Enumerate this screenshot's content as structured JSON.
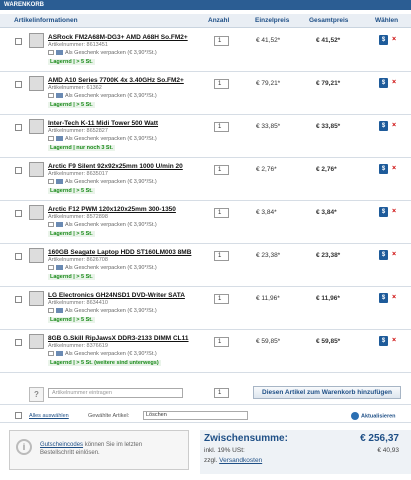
{
  "header": {
    "title": "WARENKORB"
  },
  "columns": {
    "info": "Artikelinformationen",
    "qty": "Anzahl",
    "unit": "Einzelpreis",
    "total": "Gesamtpreis",
    "select": "Wählen"
  },
  "items": [
    {
      "name": "ASRock FM2A68M-DG3+ AMD A68H So.FM2+",
      "art": "Artikelnummer: 8613451",
      "gift": "Als Geschenk verpacken (€ 3,90*/St.)",
      "stock": "Lagernd | > 5 St.",
      "qty": "1",
      "price": "€ 41,52*",
      "total": "€ 41,52*"
    },
    {
      "name": "AMD A10 Series 7700K 4x 3.40GHz So.FM2+",
      "art": "Artikelnummer: 61362",
      "gift": "Als Geschenk verpacken (€ 3,90*/St.)",
      "stock": "Lagernd | > 5 St.",
      "qty": "1",
      "price": "€ 79,21*",
      "total": "€ 79,21*"
    },
    {
      "name": "Inter-Tech K-11 Midi Tower 500 Watt",
      "art": "Artikelnummer: 8652827",
      "gift": "Als Geschenk verpacken (€ 3,90*/St.)",
      "stock": "Lagernd | nur noch 3 St.",
      "qty": "1",
      "price": "€ 33,85*",
      "total": "€ 33,85*"
    },
    {
      "name": "Arctic F9 Silent 92x92x25mm 1000 U/min 20",
      "art": "Artikelnummer: 8635017",
      "gift": "Als Geschenk verpacken (€ 3,90*/St.)",
      "stock": "Lagernd | > 5 St.",
      "qty": "1",
      "price": "€ 2,76*",
      "total": "€ 2,76*"
    },
    {
      "name": "Arctic F12 PWM 120x120x25mm 300-1350",
      "art": "Artikelnummer: 8572898",
      "gift": "Als Geschenk verpacken (€ 3,90*/St.)",
      "stock": "Lagernd | > 5 St.",
      "qty": "1",
      "price": "€ 3,84*",
      "total": "€ 3,84*"
    },
    {
      "name": "160GB Seagate Laptop HDD ST160LM003 8MB",
      "art": "Artikelnummer: 8626708",
      "gift": "Als Geschenk verpacken (€ 3,90*/St.)",
      "stock": "Lagernd | > 5 St.",
      "qty": "1",
      "price": "€ 23,38*",
      "total": "€ 23,38*"
    },
    {
      "name": "LG Electronics GH24NSD1 DVD-Writer SATA",
      "art": "Artikelnummer: 8634410",
      "gift": "Als Geschenk verpacken (€ 3,90*/St.)",
      "stock": "Lagernd | > 5 St.",
      "qty": "1",
      "price": "€ 11,96*",
      "total": "€ 11,96*"
    },
    {
      "name": "8GB G.Skill RipJawsX DDR3-2133 DIMM CL11",
      "art": "Artikelnummer: 8376619",
      "gift": "Als Geschenk verpacken (€ 3,90*/St.)",
      "stock": "Lagernd | > 5 St. (weitere sind unterwegs)",
      "qty": "1",
      "price": "€ 59,85*",
      "total": "€ 59,85*"
    }
  ],
  "add": {
    "placeholder": "Artikelnummer eintragen",
    "qty": "1",
    "button": "Diesen Artikel zum Warenkorb hinzufügen"
  },
  "selection": {
    "all": "Alles auswählen",
    "label": "Gewählte Artikel:",
    "option": "Löschen",
    "refresh": "Aktualisieren"
  },
  "coupon": {
    "link": "Gutscheincodes",
    "text": " können Sie im letzten Bestellschritt einlösen."
  },
  "summary": {
    "label": "Zwischensumme:",
    "value": "€ 256,37",
    "vat_label": "inkl. 19% USt:",
    "vat_value": "€ 40,93",
    "ship_prefix": "zzgl. ",
    "ship_link": "Versandkosten"
  },
  "icons": {
    "select": "dollar-icon",
    "remove": "close-icon",
    "coupon": "info-icon",
    "add": "question-icon",
    "refresh": "refresh-icon"
  }
}
